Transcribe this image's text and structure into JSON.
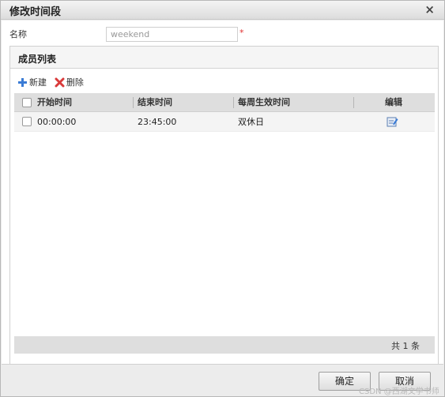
{
  "dialog": {
    "title": "修改时间段",
    "close_icon": "close-icon",
    "close_glyph": "×"
  },
  "form": {
    "name_label": "名称",
    "name_value": "weekend",
    "required_mark": "*"
  },
  "panel": {
    "title": "成员列表",
    "toolbar": {
      "new_label": "新建",
      "delete_label": "删除"
    },
    "grid": {
      "columns": [
        "开始时间",
        "结束时间",
        "每周生效时间",
        "编辑"
      ],
      "rows": [
        {
          "start": "00:00:00",
          "end": "23:45:00",
          "days": "双休日",
          "edit_icon": "edit-icon"
        }
      ]
    },
    "footer_text": "共 1 条"
  },
  "buttons": {
    "ok_label": "确定",
    "cancel_label": "取消"
  },
  "watermark": "CSDN @西湖文学书师",
  "colors": {
    "add_icon": "#3a7bd5",
    "delete_icon": "#d93a3a",
    "required": "#e03030"
  }
}
